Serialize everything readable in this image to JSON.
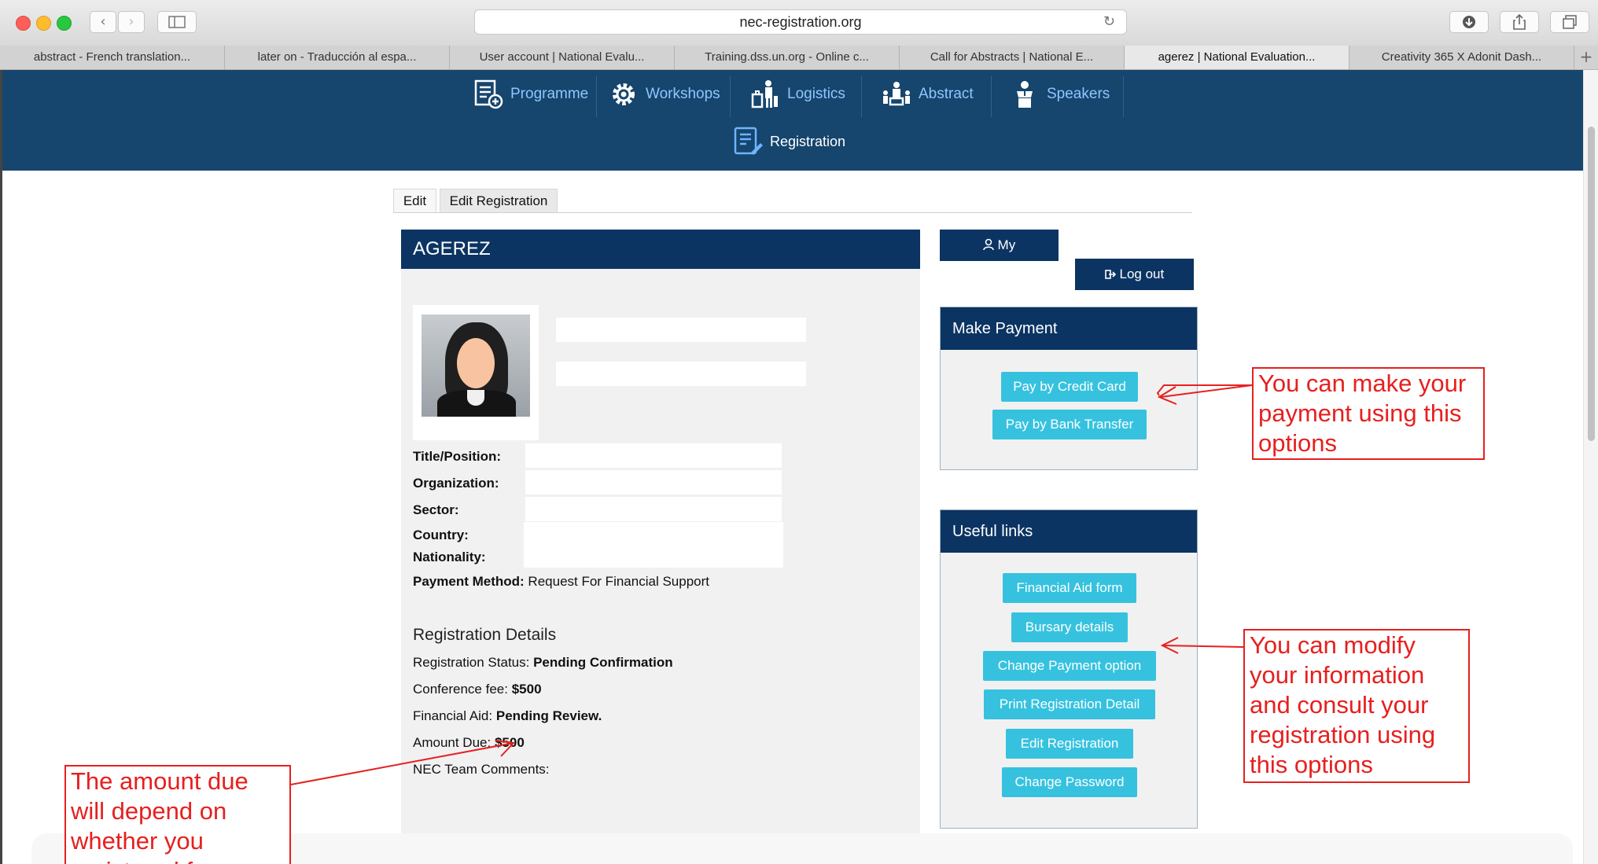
{
  "browser": {
    "url": "nec-registration.org",
    "tabs": [
      "abstract - French translation...",
      "later on - Traducción al espa...",
      "User account | National Evalu...",
      "Training.dss.un.org - Online c...",
      "Call for Abstracts | National E...",
      "agerez | National Evaluation...",
      "Creativity 365 X Adonit Dash..."
    ],
    "new_tab": "+"
  },
  "site_nav": {
    "items": [
      "Programme",
      "Workshops",
      "Logistics",
      "Abstract",
      "Speakers"
    ],
    "registration": "Registration"
  },
  "page_tabs": [
    "Edit",
    "Edit Registration"
  ],
  "profile": {
    "name": "AGEREZ",
    "labels": {
      "title": "Title/Position:",
      "organization": "Organization:",
      "sector": "Sector:",
      "country": "Country:",
      "nationality": "Nationality:",
      "payment_method": "Payment Method:"
    },
    "payment_method_value": "Request For Financial Support"
  },
  "registration": {
    "heading": "Registration Details",
    "status_label": "Registration Status:",
    "status_value": "Pending Confirmation",
    "fee_label": "Conference fee:",
    "fee_value": "$500",
    "aid_label": "Financial Aid:",
    "aid_value": "Pending Review.",
    "due_label": "Amount Due:",
    "due_value": "$500",
    "comments_label": "NEC Team Comments:"
  },
  "account": {
    "my_label": "My",
    "logout_label": "Log out"
  },
  "make_payment": {
    "heading": "Make Payment",
    "buttons": [
      "Pay by Credit Card",
      "Pay by Bank Transfer"
    ]
  },
  "useful_links": {
    "heading": "Useful links",
    "buttons": [
      "Financial Aid form",
      "Bursary details",
      "Change Payment option",
      "Print Registration Detail",
      "Edit Registration",
      "Change Password"
    ]
  },
  "annotations": {
    "payment": "You can make your payment using this options",
    "modify": "You can modify your information and consult your registration using this options",
    "amount": "The amount due will depend on whether you registered f..."
  },
  "colors": {
    "header": "#16456d",
    "panel_head": "#0b3462",
    "link_button": "#36c2df",
    "annotation": "#e6201f"
  }
}
